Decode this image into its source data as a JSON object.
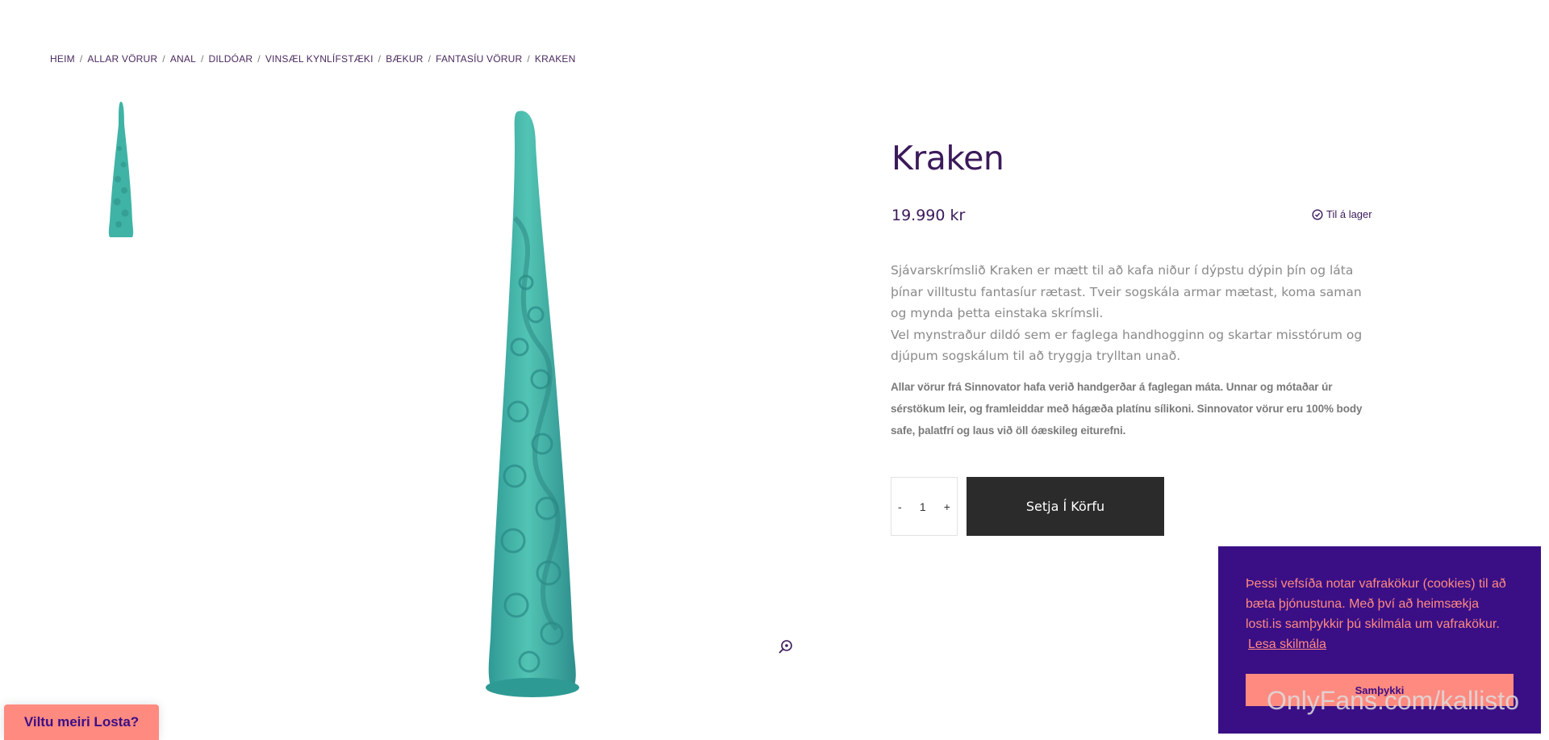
{
  "breadcrumb": {
    "items": [
      "HEIM",
      "ALLAR VÖRUR",
      "ANAL",
      "DILDÓAR",
      "VINSÆL KYNLÍFSTÆKI",
      "BÆKUR",
      "FANTASÍU VÖRUR",
      "KRAKEN"
    ],
    "separator": "/"
  },
  "product": {
    "title": "Kraken",
    "price": "19.990 kr",
    "stock": "Til á lager",
    "description_1": "Sjávarskrímslið Kraken er mætt til að kafa niður í dýpstu dýpin þín og láta þínar villtustu fantasíur rætast. Tveir sogskála armar mætast, koma saman og mynda þetta einstaka skrímsli.",
    "description_2": "Vel mynstraður dildó sem er faglega handhogginn og skartar misstórum og djúpum sogskálum til að tryggja trylltan unað.",
    "description_3": "Allar vörur frá Sinnovator hafa verið handgerðar á faglegan máta. Unnar og mótaðar úr sérstökum leir, og framleiddar með hágæða platínu sílikoni. Sinnovator vörur eru 100% body safe, þalatfrí og laus við öll óæskileg eiturefni.",
    "image_color": "#3fb3a6"
  },
  "cart": {
    "minus": "-",
    "quantity": "1",
    "plus": "+",
    "add_label": "Setja Í Körfu"
  },
  "cookie": {
    "text": "Þessi vefsíða notar vafrakökur (cookies) til að bæta þjónustuna. Með því að heimsækja losti.is samþykkir þú skilmála um vafrakökur.",
    "link": "Lesa skilmála",
    "accept": "Samþykki",
    "bg_color": "#3a0f86",
    "accent_color": "#ff8a80"
  },
  "promo": {
    "label": "Viltu meiri Losta?"
  },
  "watermark": "OnlyFans.com/kallisto",
  "icons": {
    "zoom": "zoom-in-icon",
    "stock": "check-circle-icon"
  }
}
